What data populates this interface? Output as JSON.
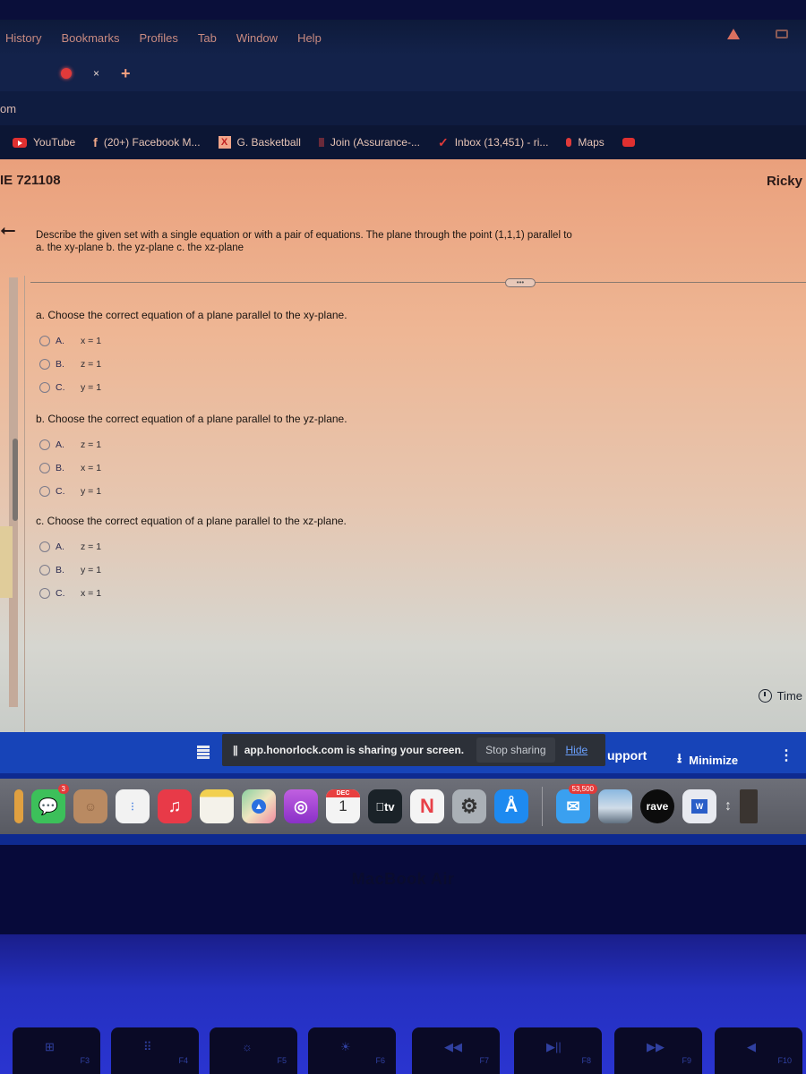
{
  "menubar": {
    "items": [
      "History",
      "Bookmarks",
      "Profiles",
      "Tab",
      "Window",
      "Help"
    ]
  },
  "tabbar": {
    "close_glyph": "×",
    "new_tab_glyph": "+"
  },
  "urlbar": {
    "prefix": "om"
  },
  "bookmarks": [
    {
      "label": "YouTube",
      "icon": "youtube-icon"
    },
    {
      "label": "(20+) Facebook M...",
      "icon": "facebook-icon"
    },
    {
      "label": "G. Basketball",
      "icon": "basketball-icon"
    },
    {
      "label": "Join (Assurance-...",
      "icon": "join-icon"
    },
    {
      "label": "Inbox (13,451) - ri...",
      "icon": "gmail-icon"
    },
    {
      "label": "Maps",
      "icon": "maps-icon"
    }
  ],
  "page": {
    "course_id": "IE 721108",
    "user_name": "Ricky",
    "back_glyph": "⭠",
    "prompt_line1": "Describe the given set with a single equation or with a pair of equations. The plane through the point (1,1,1) parallel to",
    "prompt_line2": "a. the xy-plane b. the yz-plane c. the xz-plane",
    "more_glyph": "•••",
    "parts": [
      {
        "question": "a. Choose the correct equation of a plane parallel to the xy-plane.",
        "options": [
          {
            "letter": "A.",
            "text": "x = 1"
          },
          {
            "letter": "B.",
            "text": "z = 1"
          },
          {
            "letter": "C.",
            "text": "y = 1"
          }
        ]
      },
      {
        "question": "b. Choose the correct equation of a plane parallel to the yz-plane.",
        "options": [
          {
            "letter": "A.",
            "text": "z = 1"
          },
          {
            "letter": "B.",
            "text": "x = 1"
          },
          {
            "letter": "C.",
            "text": "y = 1"
          }
        ]
      },
      {
        "question": "c. Choose the correct equation of a plane parallel to the xz-plane.",
        "options": [
          {
            "letter": "A.",
            "text": "z = 1"
          },
          {
            "letter": "B.",
            "text": "y = 1"
          },
          {
            "letter": "C.",
            "text": "x = 1"
          }
        ]
      }
    ],
    "time_label": "Time"
  },
  "proctor_bar": {
    "share_text": "app.honorlock.com is sharing your screen.",
    "pause_glyph": "||",
    "stop_sharing": "Stop sharing",
    "hide": "Hide",
    "support": "upport",
    "minimize": "Minimize",
    "download_glyph": "⭳",
    "more_glyph": "⋮"
  },
  "dock": {
    "messages_badge": "3",
    "calendar_month": "DEC",
    "calendar_day": "1",
    "tv_label": "tv",
    "mail_badge": "53,500",
    "rave_label": "rave",
    "word_label": "W",
    "resize_glyph": "↕"
  },
  "laptop": {
    "brand": "MacBook Air",
    "keys": [
      {
        "sym": "⊞",
        "label": "F3"
      },
      {
        "sym": "⠿",
        "label": "F4"
      },
      {
        "sym": "☼",
        "label": "F5"
      },
      {
        "sym": "☀",
        "label": "F6"
      },
      {
        "sym": "◀◀",
        "label": "F7"
      },
      {
        "sym": "▶||",
        "label": "F8"
      },
      {
        "sym": "▶▶",
        "label": "F9"
      },
      {
        "sym": "◀",
        "label": "F10"
      }
    ]
  }
}
